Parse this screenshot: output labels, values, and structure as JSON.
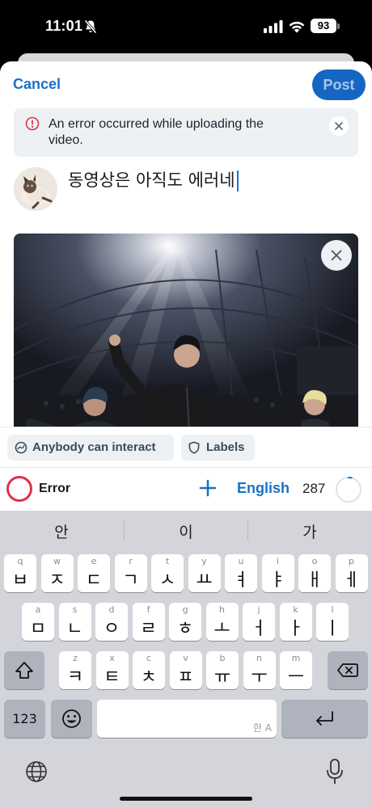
{
  "status_bar": {
    "time": "11:01",
    "battery": "93"
  },
  "header": {
    "cancel_label": "Cancel",
    "post_label": "Post"
  },
  "error_banner": {
    "message": "An error occurred while uploading the video."
  },
  "composer": {
    "text": "동영상은 아직도 에러네"
  },
  "chips": {
    "interaction": "Anybody can interact",
    "labels": "Labels"
  },
  "toolbar": {
    "status_label": "Error",
    "language": "English",
    "remaining_chars": "287",
    "progress_fraction": 0.04
  },
  "keyboard": {
    "suggestions": [
      "안",
      "이",
      "가"
    ],
    "row1": [
      {
        "jamo": "ㅂ",
        "hint": "q"
      },
      {
        "jamo": "ㅈ",
        "hint": "w"
      },
      {
        "jamo": "ㄷ",
        "hint": "e"
      },
      {
        "jamo": "ㄱ",
        "hint": "r"
      },
      {
        "jamo": "ㅅ",
        "hint": "t"
      },
      {
        "jamo": "ㅛ",
        "hint": "y"
      },
      {
        "jamo": "ㅕ",
        "hint": "u"
      },
      {
        "jamo": "ㅑ",
        "hint": "i"
      },
      {
        "jamo": "ㅐ",
        "hint": "o"
      },
      {
        "jamo": "ㅔ",
        "hint": "p"
      }
    ],
    "row2": [
      {
        "jamo": "ㅁ",
        "hint": "a"
      },
      {
        "jamo": "ㄴ",
        "hint": "s"
      },
      {
        "jamo": "ㅇ",
        "hint": "d"
      },
      {
        "jamo": "ㄹ",
        "hint": "f"
      },
      {
        "jamo": "ㅎ",
        "hint": "g"
      },
      {
        "jamo": "ㅗ",
        "hint": "h"
      },
      {
        "jamo": "ㅓ",
        "hint": "j"
      },
      {
        "jamo": "ㅏ",
        "hint": "k"
      },
      {
        "jamo": "ㅣ",
        "hint": "l"
      }
    ],
    "row3": [
      {
        "jamo": "ㅋ",
        "hint": "z"
      },
      {
        "jamo": "ㅌ",
        "hint": "x"
      },
      {
        "jamo": "ㅊ",
        "hint": "c"
      },
      {
        "jamo": "ㅍ",
        "hint": "v"
      },
      {
        "jamo": "ㅠ",
        "hint": "b"
      },
      {
        "jamo": "ㅜ",
        "hint": "n"
      },
      {
        "jamo": "ㅡ",
        "hint": "m"
      }
    ],
    "numbers_label": "123",
    "space_hint": "한 A"
  },
  "colors": {
    "accent": "#1872c7",
    "post_button": "#1566c2",
    "error": "#e0304a",
    "keyboard_bg": "#d3d5db"
  }
}
